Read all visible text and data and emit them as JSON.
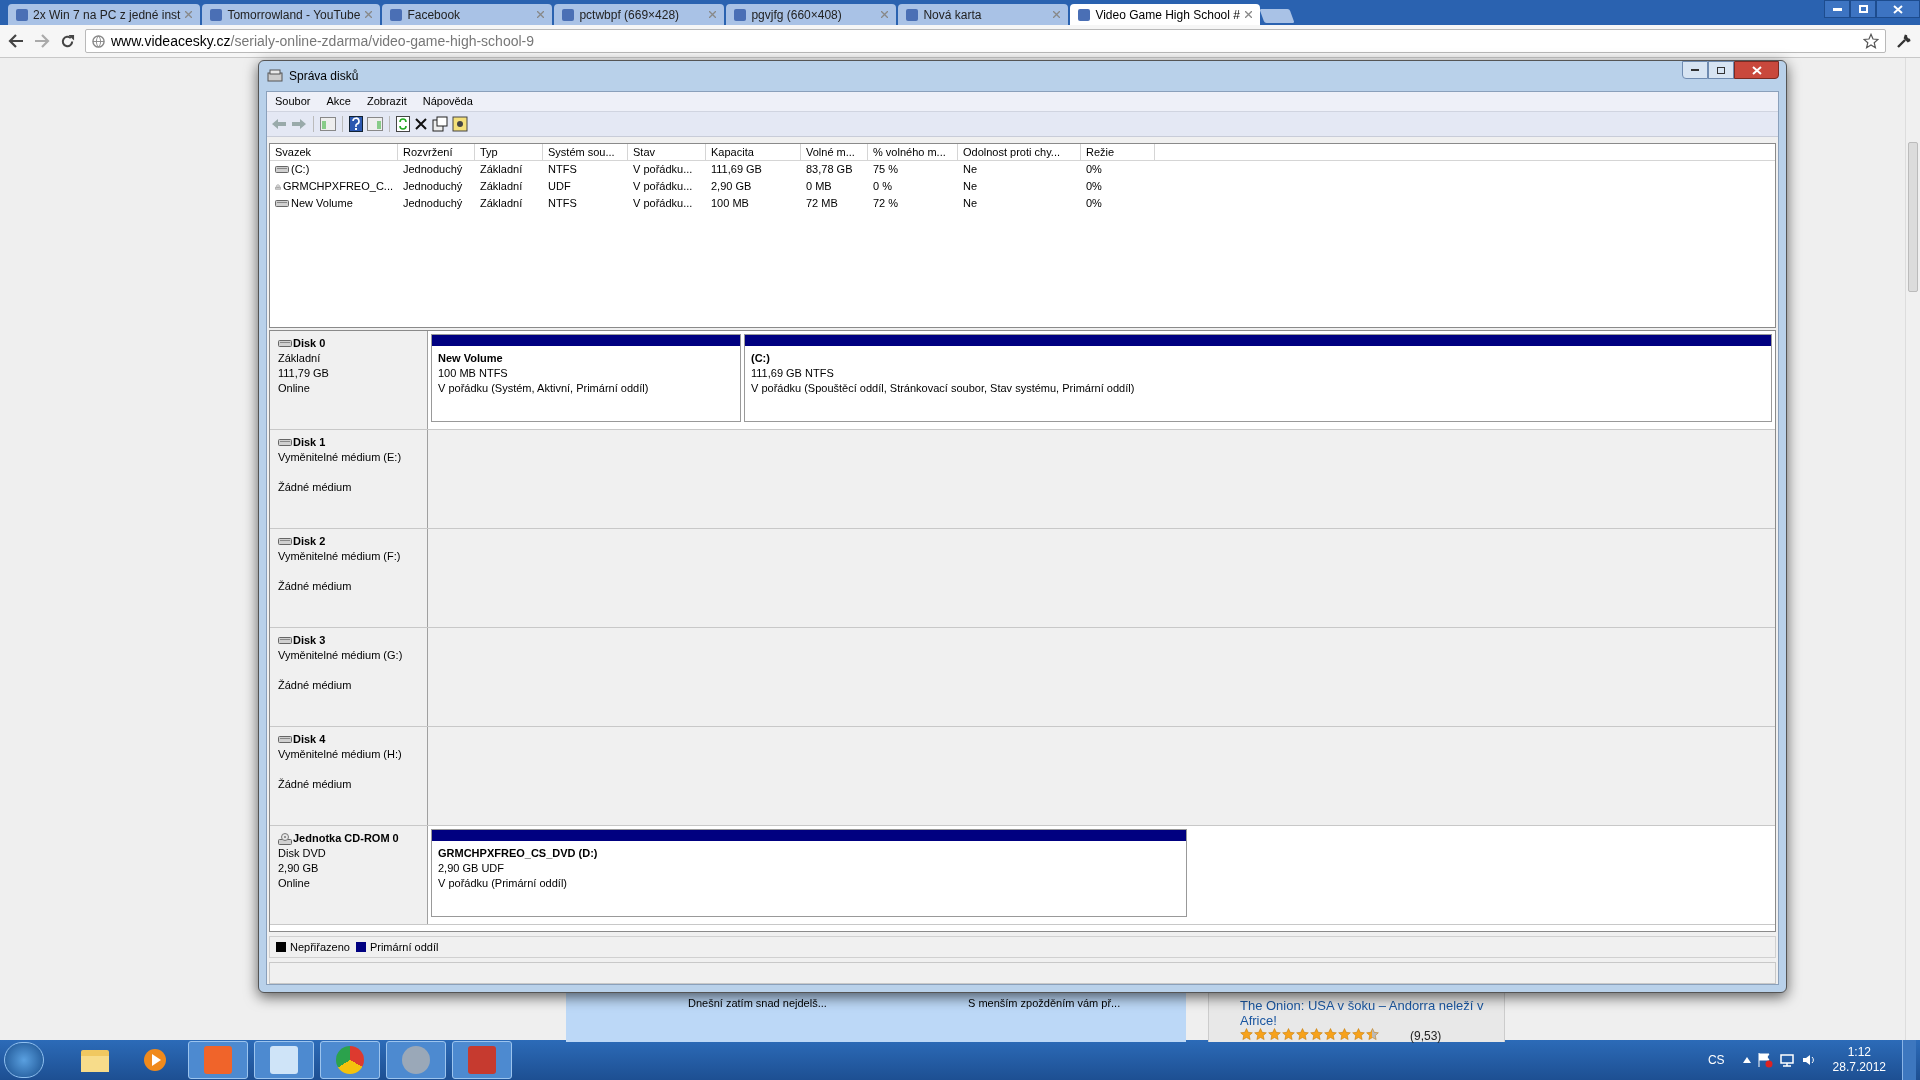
{
  "browser": {
    "tabs": [
      {
        "title": "2x Win 7 na PC z jedné inst",
        "selected": false
      },
      {
        "title": "Tomorrowland - YouTube",
        "selected": false
      },
      {
        "title": "Facebook",
        "selected": false
      },
      {
        "title": "pctwbpf (669×428)",
        "selected": false
      },
      {
        "title": "pgvjfg (660×408)",
        "selected": false
      },
      {
        "title": "Nová karta",
        "selected": false
      },
      {
        "title": "Video Game High School #",
        "selected": true
      }
    ],
    "address": {
      "domain": "www.videacesky.cz",
      "path": "/serialy-online-zdarma/video-game-high-school-9"
    }
  },
  "page": {
    "captions": [
      "Dnešní zatím snad nejdelš...",
      "S menším zpožděním vám př..."
    ],
    "article": {
      "title": "The Onion: USA v šoku – Andorra neleží v Africe!",
      "stars": 9.5,
      "rating": "(9,53)"
    }
  },
  "window": {
    "title": "Správa disků",
    "menu": [
      "Soubor",
      "Akce",
      "Zobrazit",
      "Nápověda"
    ],
    "volumes": {
      "columns": [
        "Svazek",
        "Rozvržení",
        "Typ",
        "Systém sou...",
        "Stav",
        "Kapacita",
        "Volné m...",
        "% volného m...",
        "Odolnost proti chy...",
        "Režie"
      ],
      "rows": [
        {
          "kind": "disk",
          "cells": [
            "(C:)",
            "Jednoduchý",
            "Základní",
            "NTFS",
            "V pořádku...",
            "111,69 GB",
            "83,78 GB",
            "75 %",
            "Ne",
            "0%"
          ]
        },
        {
          "kind": "cd",
          "cells": [
            "GRMCHPXFREO_C...",
            "Jednoduchý",
            "Základní",
            "UDF",
            "V pořádku...",
            "2,90 GB",
            "0 MB",
            "0 %",
            "Ne",
            "0%"
          ]
        },
        {
          "kind": "disk",
          "cells": [
            "New Volume",
            "Jednoduchý",
            "Základní",
            "NTFS",
            "V pořádku...",
            "100 MB",
            "72 MB",
            "72 %",
            "Ne",
            "0%"
          ]
        }
      ]
    },
    "disks": [
      {
        "kind": "basic",
        "name": "Disk 0",
        "type": "Základní",
        "size": "111,79 GB",
        "status": "Online",
        "partitions": [
          {
            "name": "New Volume",
            "size": "100 MB NTFS",
            "status": "V pořádku (Systém, Aktivní, Primární oddíl)"
          },
          {
            "name": "(C:)",
            "size": "111,69 GB NTFS",
            "status": "V pořádku (Spouštěcí oddíl, Stránkovací soubor, Stav systému, Primární oddíl)"
          }
        ]
      },
      {
        "kind": "removable",
        "name": "Disk 1",
        "type": "Vyměnitelné médium (E:)",
        "status": "Žádné médium"
      },
      {
        "kind": "removable",
        "name": "Disk 2",
        "type": "Vyměnitelné médium (F:)",
        "status": "Žádné médium"
      },
      {
        "kind": "removable",
        "name": "Disk 3",
        "type": "Vyměnitelné médium (G:)",
        "status": "Žádné médium"
      },
      {
        "kind": "removable",
        "name": "Disk 4",
        "type": "Vyměnitelné médium (H:)",
        "status": "Žádné médium"
      },
      {
        "kind": "cdrom",
        "name": "Jednotka CD-ROM 0",
        "type": "Disk DVD",
        "size": "2,90 GB",
        "status": "Online",
        "partitions": [
          {
            "name": "GRMCHPXFREO_CS_DVD  (D:)",
            "size": "2,90 GB UDF",
            "status": "V pořádku (Primární oddíl)"
          }
        ]
      }
    ],
    "legend": [
      {
        "label": "Nepřiřazeno",
        "color": "#000000"
      },
      {
        "label": "Primární oddíl",
        "color": "#000080"
      }
    ]
  },
  "taskbar": {
    "language": "CS",
    "time": "1:12",
    "date": "28.7.2012"
  }
}
